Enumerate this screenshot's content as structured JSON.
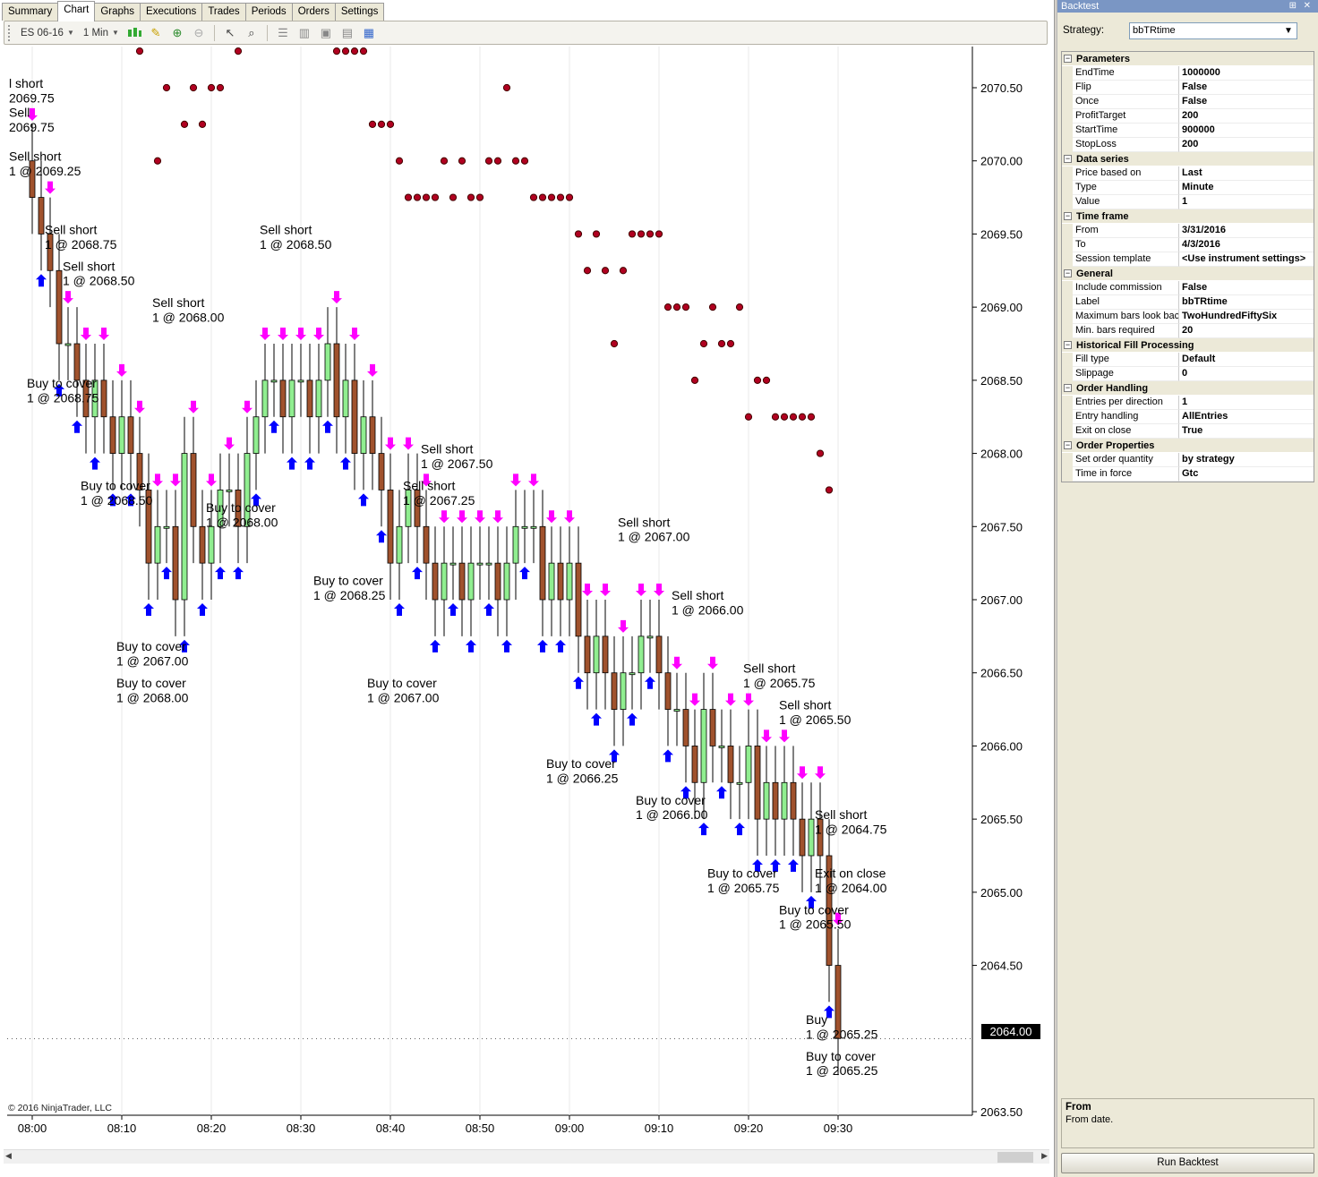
{
  "tabs": [
    "Summary",
    "Chart",
    "Graphs",
    "Executions",
    "Trades",
    "Periods",
    "Orders",
    "Settings"
  ],
  "active_tab": "Chart",
  "toolbar": {
    "instrument": "ES 06-16",
    "interval": "1 Min"
  },
  "chart": {
    "copyright": "© 2016 NinjaTrader, LLC",
    "last_price": "2064.00",
    "y_ticks": [
      "2070.50",
      "2070.00",
      "2069.50",
      "2069.00",
      "2068.50",
      "2068.00",
      "2067.50",
      "2067.00",
      "2066.50",
      "2066.00",
      "2065.50",
      "2065.00",
      "2064.50",
      "2063.50"
    ],
    "x_ticks": [
      "08:00",
      "08:10",
      "08:20",
      "08:30",
      "08:40",
      "08:50",
      "09:00",
      "09:10",
      "09:20",
      "09:30"
    ],
    "colors": {
      "up_bar": "#90ee90",
      "down_bar": "#a0522d",
      "sell_arrow": "#ff00ff",
      "buy_arrow": "#0000ff",
      "dot": "#b00020"
    }
  },
  "chart_data": {
    "type": "candlestick",
    "x": [
      "08:00",
      "08:01",
      "08:02",
      "08:03",
      "08:04",
      "08:05",
      "08:06",
      "08:07",
      "08:08",
      "08:09",
      "08:10",
      "08:11",
      "08:12",
      "08:13",
      "08:14",
      "08:15",
      "08:16",
      "08:17",
      "08:18",
      "08:19",
      "08:20",
      "08:21",
      "08:22",
      "08:23",
      "08:24",
      "08:25",
      "08:26",
      "08:27",
      "08:28",
      "08:29",
      "08:30",
      "08:31",
      "08:32",
      "08:33",
      "08:34",
      "08:35",
      "08:36",
      "08:37",
      "08:38",
      "08:39",
      "08:40",
      "08:41",
      "08:42",
      "08:43",
      "08:44",
      "08:45",
      "08:46",
      "08:47",
      "08:48",
      "08:49",
      "08:50",
      "08:51",
      "08:52",
      "08:53",
      "08:54",
      "08:55",
      "08:56",
      "08:57",
      "08:58",
      "08:59",
      "09:00",
      "09:01",
      "09:02",
      "09:03",
      "09:04",
      "09:05",
      "09:06",
      "09:07",
      "09:08",
      "09:09",
      "09:10",
      "09:11",
      "09:12",
      "09:13",
      "09:14",
      "09:15",
      "09:16",
      "09:17",
      "09:18",
      "09:19",
      "09:20",
      "09:21",
      "09:22",
      "09:23",
      "09:24",
      "09:25",
      "09:26",
      "09:27",
      "09:28",
      "09:29",
      "09:30"
    ],
    "close": [
      2069.75,
      2069.5,
      2069.25,
      2068.75,
      2068.75,
      2068.5,
      2068.25,
      2068.5,
      2068.25,
      2068.0,
      2068.25,
      2068.0,
      2067.75,
      2067.25,
      2067.5,
      2067.5,
      2067.0,
      2068.0,
      2067.5,
      2067.25,
      2067.5,
      2067.75,
      2067.75,
      2067.5,
      2068.0,
      2068.25,
      2068.5,
      2068.5,
      2068.25,
      2068.5,
      2068.5,
      2068.25,
      2068.5,
      2068.75,
      2068.25,
      2068.5,
      2068.0,
      2068.25,
      2068.0,
      2067.75,
      2067.25,
      2067.5,
      2067.75,
      2067.5,
      2067.25,
      2067.0,
      2067.25,
      2067.25,
      2067.0,
      2067.25,
      2067.25,
      2067.25,
      2067.0,
      2067.25,
      2067.5,
      2067.5,
      2067.5,
      2067.0,
      2067.25,
      2067.0,
      2067.25,
      2066.75,
      2066.5,
      2066.75,
      2066.5,
      2066.25,
      2066.5,
      2066.5,
      2066.75,
      2066.75,
      2066.5,
      2066.25,
      2066.25,
      2066.0,
      2065.75,
      2066.25,
      2066.0,
      2066.0,
      2065.75,
      2065.75,
      2066.0,
      2065.5,
      2065.75,
      2065.5,
      2065.75,
      2065.5,
      2065.25,
      2065.5,
      2065.25,
      2064.5,
      2064.0
    ],
    "dots": [
      [
        8.12,
        2070.75
      ],
      [
        8.14,
        2070.0
      ],
      [
        8.15,
        2070.5
      ],
      [
        8.17,
        2070.25
      ],
      [
        8.18,
        2070.5
      ],
      [
        8.19,
        2070.25
      ],
      [
        8.2,
        2070.5
      ],
      [
        8.21,
        2070.5
      ],
      [
        8.23,
        2070.75
      ],
      [
        8.34,
        2070.75
      ],
      [
        8.35,
        2070.75
      ],
      [
        8.36,
        2070.75
      ],
      [
        8.37,
        2070.75
      ],
      [
        8.38,
        2070.25
      ],
      [
        8.39,
        2070.25
      ],
      [
        8.4,
        2070.25
      ],
      [
        8.41,
        2070.0
      ],
      [
        8.42,
        2069.75
      ],
      [
        8.43,
        2069.75
      ],
      [
        8.44,
        2069.75
      ],
      [
        8.45,
        2069.75
      ],
      [
        8.46,
        2070.0
      ],
      [
        8.47,
        2069.75
      ],
      [
        8.48,
        2070.0
      ],
      [
        8.49,
        2069.75
      ],
      [
        8.5,
        2069.75
      ],
      [
        8.51,
        2070.0
      ],
      [
        8.52,
        2070.0
      ],
      [
        8.53,
        2070.5
      ],
      [
        8.54,
        2070.0
      ],
      [
        8.55,
        2070.0
      ],
      [
        8.56,
        2069.75
      ],
      [
        8.57,
        2069.75
      ],
      [
        8.58,
        2069.75
      ],
      [
        8.59,
        2069.75
      ],
      [
        9.0,
        2069.75
      ],
      [
        9.01,
        2069.5
      ],
      [
        9.02,
        2069.25
      ],
      [
        9.03,
        2069.5
      ],
      [
        9.04,
        2069.25
      ],
      [
        9.05,
        2068.75
      ],
      [
        9.06,
        2069.25
      ],
      [
        9.07,
        2069.5
      ],
      [
        9.08,
        2069.5
      ],
      [
        9.09,
        2069.5
      ],
      [
        9.1,
        2069.5
      ],
      [
        9.11,
        2069.0
      ],
      [
        9.12,
        2069.0
      ],
      [
        9.13,
        2069.0
      ],
      [
        9.14,
        2068.5
      ],
      [
        9.15,
        2068.75
      ],
      [
        9.16,
        2069.0
      ],
      [
        9.17,
        2068.75
      ],
      [
        9.18,
        2068.75
      ],
      [
        9.19,
        2069.0
      ],
      [
        9.2,
        2068.25
      ],
      [
        9.21,
        2068.5
      ],
      [
        9.22,
        2068.5
      ],
      [
        9.23,
        2068.25
      ],
      [
        9.24,
        2068.25
      ],
      [
        9.25,
        2068.25
      ],
      [
        9.26,
        2068.25
      ],
      [
        9.27,
        2068.25
      ],
      [
        9.28,
        2068.0
      ],
      [
        9.29,
        2067.75
      ]
    ],
    "ylim": [
      2063.5,
      2070.75
    ]
  },
  "annotations": [
    {
      "t": "l short",
      "tick": 0.0,
      "price": 2070.5
    },
    {
      "t": "2069.75",
      "tick": 0.0,
      "price": 2070.4
    },
    {
      "t": "Sell",
      "tick": 0.0,
      "price": 2070.3
    },
    {
      "t": "2069.75",
      "tick": 0.0,
      "price": 2070.2
    },
    {
      "t": "Sell short",
      "tick": 0.0,
      "price": 2070.0
    },
    {
      "t": "1 @ 2069.25",
      "tick": 0.0,
      "price": 2069.9
    },
    {
      "t": "Sell short",
      "tick": 4.0,
      "price": 2069.5
    },
    {
      "t": "1 @ 2068.75",
      "tick": 4.0,
      "price": 2069.4
    },
    {
      "t": "Sell short",
      "tick": 6.0,
      "price": 2069.25
    },
    {
      "t": "1 @ 2068.50",
      "tick": 6.0,
      "price": 2069.15
    },
    {
      "t": "Sell short",
      "tick": 28.0,
      "price": 2069.5
    },
    {
      "t": "1 @ 2068.50",
      "tick": 28.0,
      "price": 2069.4
    },
    {
      "t": "Sell short",
      "tick": 16.0,
      "price": 2069.0
    },
    {
      "t": "1 @ 2068.00",
      "tick": 16.0,
      "price": 2068.9
    },
    {
      "t": "Buy to cover",
      "tick": 2.0,
      "price": 2068.45
    },
    {
      "t": "1 @ 2068.75",
      "tick": 2.0,
      "price": 2068.35
    },
    {
      "t": "Buy to cover",
      "tick": 8.0,
      "price": 2067.75
    },
    {
      "t": "1 @ 2068.50",
      "tick": 8.0,
      "price": 2067.65
    },
    {
      "t": "Buy to cover",
      "tick": 22.0,
      "price": 2067.6
    },
    {
      "t": "1 @ 2068.00",
      "tick": 22.0,
      "price": 2067.5
    },
    {
      "t": "Buy to cover",
      "tick": 12.0,
      "price": 2066.65
    },
    {
      "t": "1 @ 2067.00",
      "tick": 12.0,
      "price": 2066.55
    },
    {
      "t": "Buy to cover",
      "tick": 12.0,
      "price": 2066.4
    },
    {
      "t": "1 @ 2068.00",
      "tick": 12.0,
      "price": 2066.3
    },
    {
      "t": "Sell short",
      "tick": 46.0,
      "price": 2068.0
    },
    {
      "t": "1 @ 2067.50",
      "tick": 46.0,
      "price": 2067.9
    },
    {
      "t": "Sell short",
      "tick": 44.0,
      "price": 2067.75
    },
    {
      "t": "1 @ 2067.25",
      "tick": 44.0,
      "price": 2067.65
    },
    {
      "t": "Buy to cover",
      "tick": 34.0,
      "price": 2067.1
    },
    {
      "t": "1 @ 2068.25",
      "tick": 34.0,
      "price": 2067.0
    },
    {
      "t": "Buy to cover",
      "tick": 40.0,
      "price": 2066.4
    },
    {
      "t": "1 @ 2067.00",
      "tick": 40.0,
      "price": 2066.3
    },
    {
      "t": "Sell short",
      "tick": 68.0,
      "price": 2067.5
    },
    {
      "t": "1 @ 2067.00",
      "tick": 68.0,
      "price": 2067.4
    },
    {
      "t": "Sell short",
      "tick": 74.0,
      "price": 2067.0
    },
    {
      "t": "1 @ 2066.00",
      "tick": 74.0,
      "price": 2066.9
    },
    {
      "t": "Sell short",
      "tick": 82.0,
      "price": 2066.5
    },
    {
      "t": "1 @ 2065.75",
      "tick": 82.0,
      "price": 2066.4
    },
    {
      "t": "Sell short",
      "tick": 86.0,
      "price": 2066.25
    },
    {
      "t": "1 @ 2065.50",
      "tick": 86.0,
      "price": 2066.15
    },
    {
      "t": "Sell short",
      "tick": 90.0,
      "price": 2065.5
    },
    {
      "t": "1 @ 2064.75",
      "tick": 90.0,
      "price": 2065.4
    },
    {
      "t": "Buy to cover",
      "tick": 60.0,
      "price": 2065.85
    },
    {
      "t": "1 @ 2066.25",
      "tick": 60.0,
      "price": 2065.75
    },
    {
      "t": "Buy to cover",
      "tick": 70.0,
      "price": 2065.6
    },
    {
      "t": "1 @ 2066.00",
      "tick": 70.0,
      "price": 2065.5
    },
    {
      "t": "Buy to cover",
      "tick": 78.0,
      "price": 2065.1
    },
    {
      "t": "1 @ 2065.75",
      "tick": 78.0,
      "price": 2065.0
    },
    {
      "t": "Exit on close",
      "tick": 90.0,
      "price": 2065.1
    },
    {
      "t": "1 @ 2064.00",
      "tick": 90.0,
      "price": 2065.0
    },
    {
      "t": "Buy to cover",
      "tick": 86.0,
      "price": 2064.85
    },
    {
      "t": "1 @ 2065.50",
      "tick": 86.0,
      "price": 2064.75
    },
    {
      "t": "Buy",
      "tick": 89.0,
      "price": 2064.1
    },
    {
      "t": "1 @ 2065.25",
      "tick": 89.0,
      "price": 2064.0
    },
    {
      "t": "Buy to cover",
      "tick": 89.0,
      "price": 2063.85
    },
    {
      "t": "1 @ 2065.25",
      "tick": 89.0,
      "price": 2063.75
    }
  ],
  "panel": {
    "title": "Backtest",
    "strategy_label": "Strategy:",
    "strategy_value": "bbTRtime",
    "categories": [
      {
        "name": "Parameters",
        "rows": [
          [
            "EndTime",
            "1000000"
          ],
          [
            "Flip",
            "False"
          ],
          [
            "Once",
            "False"
          ],
          [
            "ProfitTarget",
            "200"
          ],
          [
            "StartTime",
            "900000"
          ],
          [
            "StopLoss",
            "200"
          ]
        ]
      },
      {
        "name": "Data series",
        "rows": [
          [
            "Price based on",
            "Last"
          ],
          [
            "Type",
            "Minute"
          ],
          [
            "Value",
            "1"
          ]
        ]
      },
      {
        "name": "Time frame",
        "rows": [
          [
            "From",
            "3/31/2016"
          ],
          [
            "To",
            "4/3/2016"
          ],
          [
            "Session template",
            "<Use instrument settings>"
          ]
        ]
      },
      {
        "name": "General",
        "rows": [
          [
            "Include commission",
            "False"
          ],
          [
            "Label",
            "bbTRtime"
          ],
          [
            "Maximum bars look back",
            "TwoHundredFiftySix"
          ],
          [
            "Min. bars required",
            "20"
          ]
        ]
      },
      {
        "name": "Historical Fill Processing",
        "rows": [
          [
            "Fill type",
            "Default"
          ],
          [
            "Slippage",
            "0"
          ]
        ]
      },
      {
        "name": "Order Handling",
        "rows": [
          [
            "Entries per direction",
            "1"
          ],
          [
            "Entry handling",
            "AllEntries"
          ],
          [
            "Exit on close",
            "True"
          ]
        ]
      },
      {
        "name": "Order Properties",
        "rows": [
          [
            "Set order quantity",
            "by strategy"
          ],
          [
            "Time in force",
            "Gtc"
          ]
        ]
      }
    ],
    "help_title": "From",
    "help_text": "From date.",
    "run_button": "Run Backtest"
  }
}
